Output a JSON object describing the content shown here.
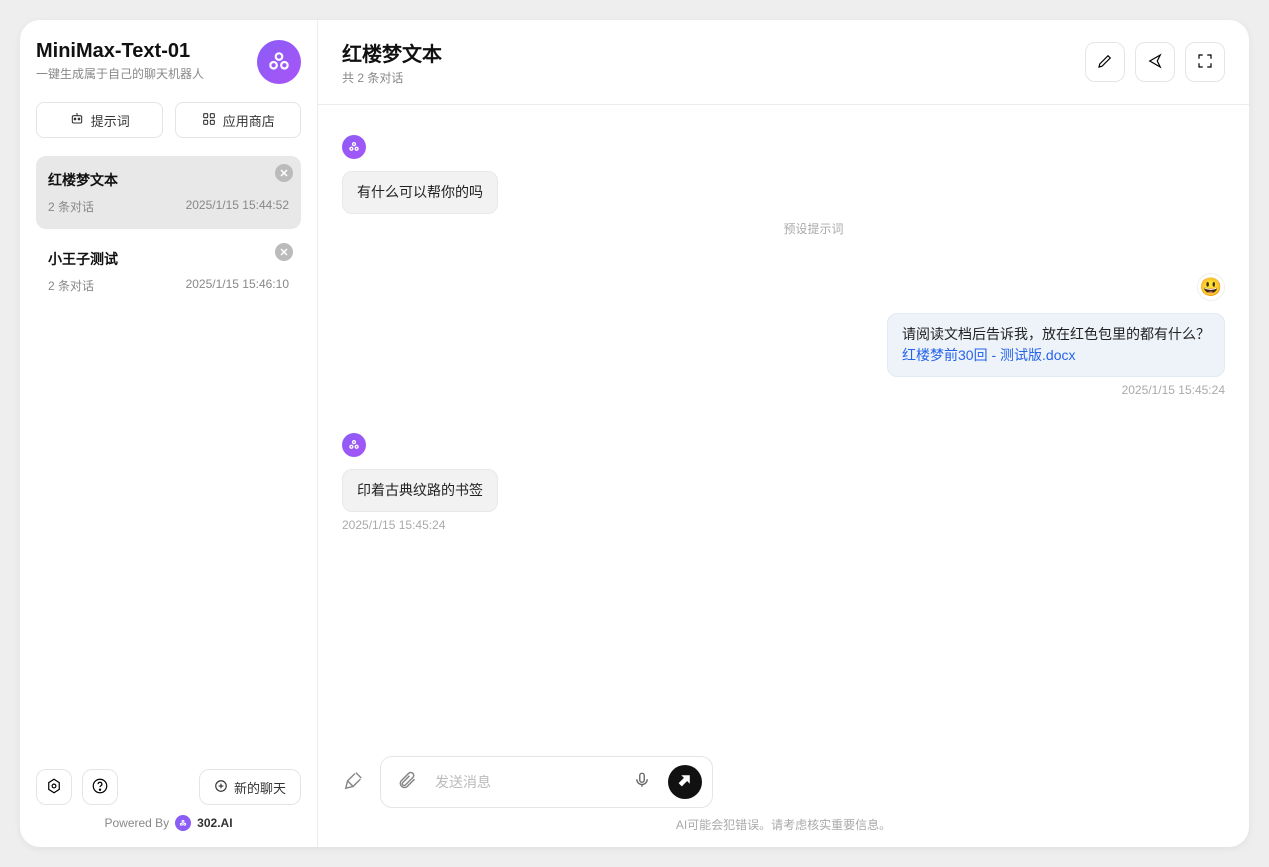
{
  "sidebar": {
    "title": "MiniMax-Text-01",
    "subtitle": "一键生成属于自己的聊天机器人",
    "buttons": {
      "prompt": "提示词",
      "store": "应用商店"
    },
    "chats": [
      {
        "title": "红楼梦文本",
        "count": "2 条对话",
        "time": "2025/1/15 15:44:52",
        "active": true
      },
      {
        "title": "小王子测试",
        "count": "2 条对话",
        "time": "2025/1/15 15:46:10",
        "active": false
      }
    ],
    "new_chat": "新的聊天",
    "powered_by": "Powered By",
    "brand": "302.AI"
  },
  "header": {
    "title": "红楼梦文本",
    "subtitle": "共 2 条对话"
  },
  "messages": [
    {
      "role": "assistant",
      "text": "有什么可以帮你的吗",
      "caption": "预设提示词"
    },
    {
      "role": "user",
      "text": "请阅读文档后告诉我，放在红色包里的都有什么？",
      "attachment": "红楼梦前30回 - 测试版.docx",
      "caption": "2025/1/15 15:45:24"
    },
    {
      "role": "assistant",
      "text": "印着古典纹路的书签",
      "caption": "2025/1/15 15:45:24"
    }
  ],
  "composer": {
    "placeholder": "发送消息"
  },
  "disclaimer": "AI可能会犯错误。请考虑核实重要信息。"
}
